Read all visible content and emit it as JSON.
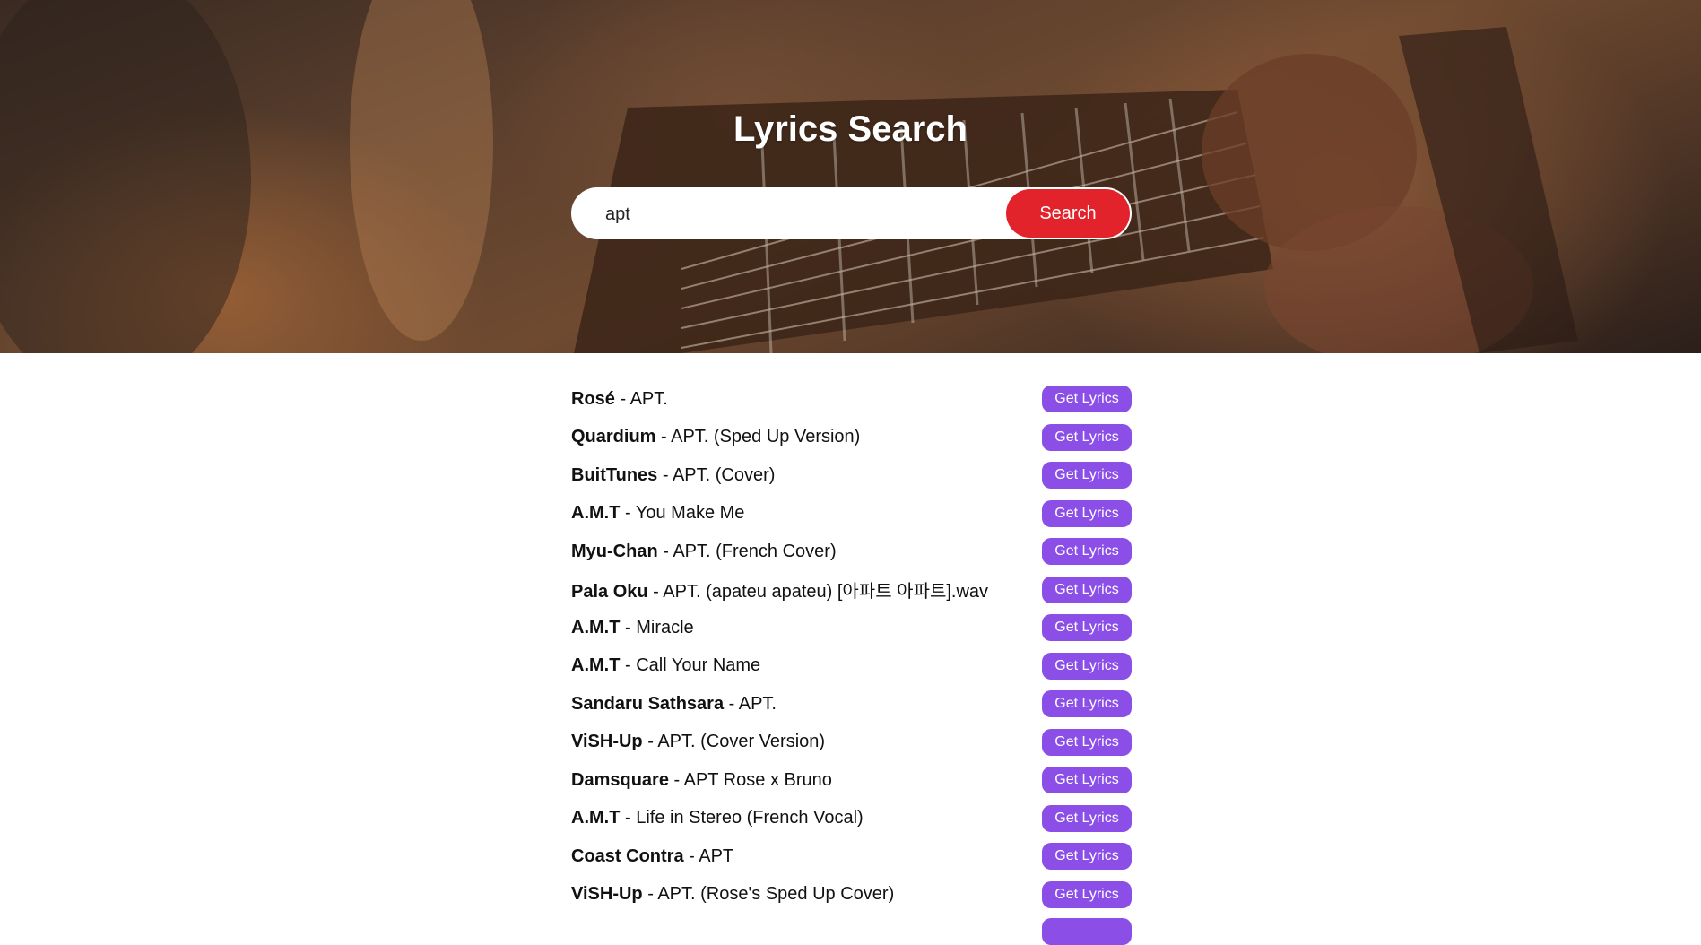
{
  "header": {
    "title": "Lyrics Search"
  },
  "search": {
    "value": "apt",
    "button_label": "Search"
  },
  "colors": {
    "search_button": "#e3232c",
    "lyrics_button": "#8b4fe8"
  },
  "results": [
    {
      "artist": "Rosé",
      "title": "APT.",
      "button": "Get Lyrics"
    },
    {
      "artist": "Quardium",
      "title": "APT. (Sped Up Version)",
      "button": "Get Lyrics"
    },
    {
      "artist": "BuitTunes",
      "title": "APT. (Cover)",
      "button": "Get Lyrics"
    },
    {
      "artist": "A.M.T",
      "title": "You Make Me",
      "button": "Get Lyrics"
    },
    {
      "artist": "Myu-Chan",
      "title": "APT. (French Cover)",
      "button": "Get Lyrics"
    },
    {
      "artist": "Pala Oku",
      "title": "APT. (apateu apateu) [아파트 아파트].wav",
      "button": "Get Lyrics"
    },
    {
      "artist": "A.M.T",
      "title": "Miracle",
      "button": "Get Lyrics"
    },
    {
      "artist": "A.M.T",
      "title": "Call Your Name",
      "button": "Get Lyrics"
    },
    {
      "artist": "Sandaru Sathsara",
      "title": "APT.",
      "button": "Get Lyrics"
    },
    {
      "artist": "ViSH-Up",
      "title": "APT. (Cover Version)",
      "button": "Get Lyrics"
    },
    {
      "artist": "Damsquare",
      "title": "APT Rose x Bruno",
      "button": "Get Lyrics"
    },
    {
      "artist": "A.M.T",
      "title": "Life in Stereo (French Vocal)",
      "button": "Get Lyrics"
    },
    {
      "artist": "Coast Contra",
      "title": "APT",
      "button": "Get Lyrics"
    },
    {
      "artist": "ViSH-Up",
      "title": "APT. (Rose's Sped Up Cover)",
      "button": "Get Lyrics"
    }
  ]
}
